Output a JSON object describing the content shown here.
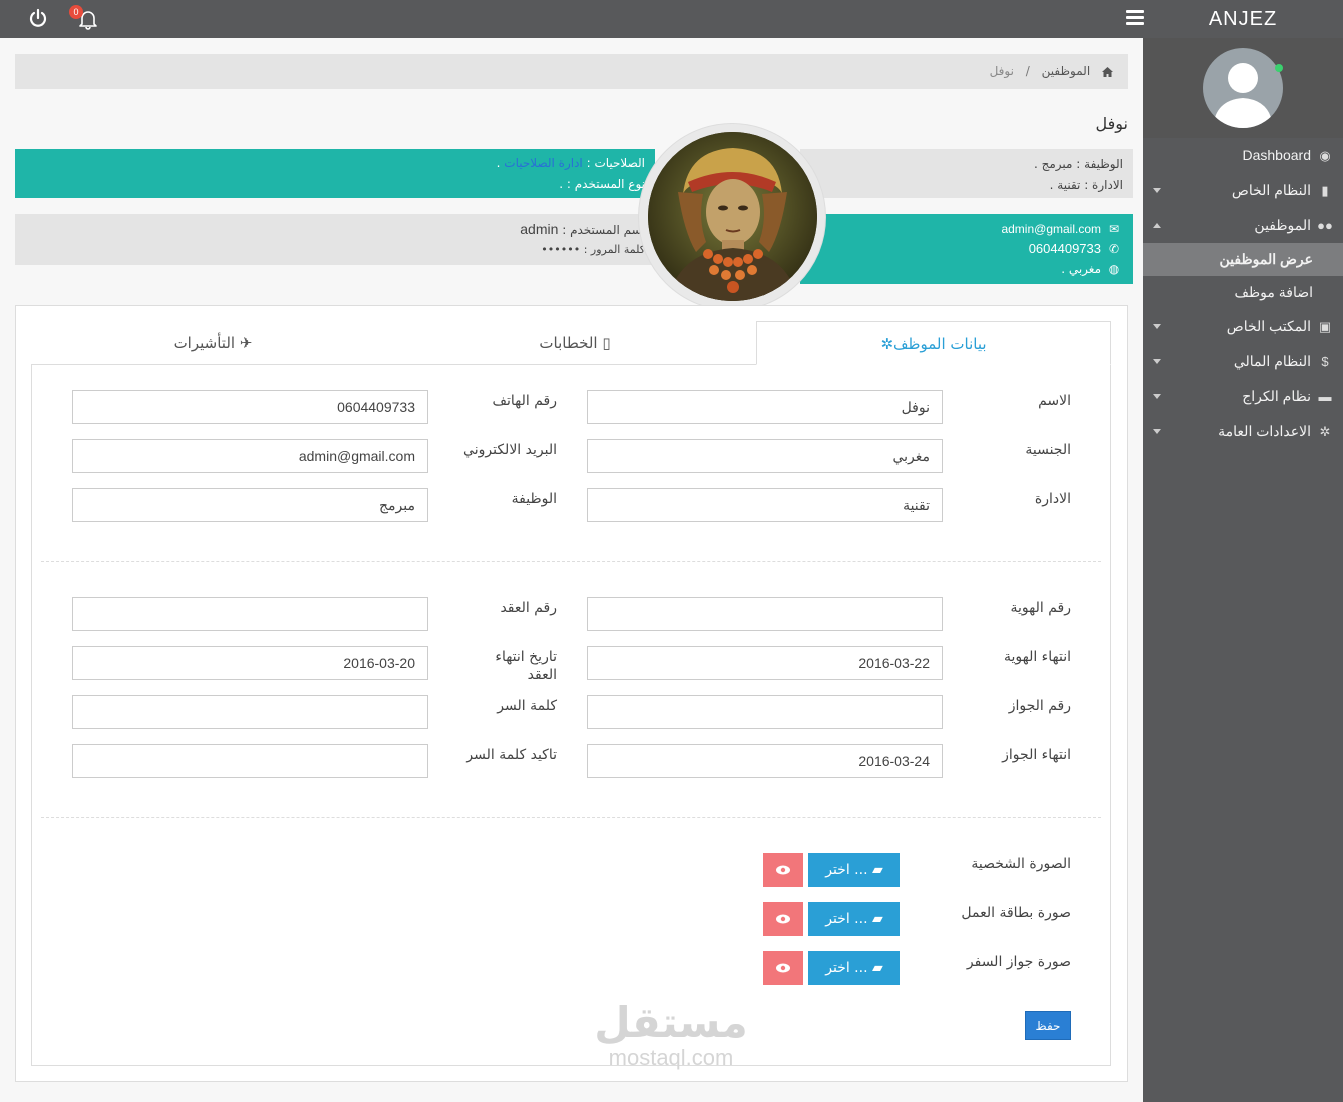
{
  "header": {
    "brand": "ANJEZ",
    "notification_count": "0"
  },
  "sidebar": {
    "items": [
      {
        "label": "Dashboard",
        "icon": "dashboard-icon"
      },
      {
        "label": "النظام الخاص",
        "icon": "bookmark-icon"
      },
      {
        "label": "الموظفين",
        "icon": "users-icon"
      },
      {
        "label": "المكتب الخاص",
        "icon": "office-icon"
      },
      {
        "label": "النظام المالي",
        "icon": "dollar-icon"
      },
      {
        "label": "نظام الكراج",
        "icon": "car-icon"
      },
      {
        "label": "الاعدادات العامة",
        "icon": "cogs-icon"
      }
    ],
    "sub_items": [
      {
        "label": "عرض الموظفين",
        "active": true
      },
      {
        "label": "اضافة موظف",
        "active": false
      }
    ]
  },
  "breadcrumb": {
    "parent": "الموظفين",
    "current": "نوفل",
    "sep": "/"
  },
  "employee": {
    "name": "نوفل",
    "job_line": "الوظيفة : مبرمج .",
    "dept_line": "الادارة : تقنية .",
    "perm_label": "الصلاحيات : ",
    "perm_value": "ادارة الصلاحيات",
    "perm_end": " .",
    "usertype_line": "نوع المستخدم : .",
    "username_label": "اسم المستخدم : ",
    "username": "admin",
    "password_line": "كلمة المرور : ••••••",
    "email": "admin@gmail.com",
    "phone": "0604409733",
    "nationality_line": "مغربي ."
  },
  "tabs": [
    {
      "label": "بيانات الموظف",
      "icon": "cogs-icon",
      "active": true
    },
    {
      "label": "الخطابات",
      "icon": "file-icon",
      "active": false
    },
    {
      "label": "التأشيرات",
      "icon": "plane-icon",
      "active": false
    }
  ],
  "form": {
    "name_label": "الاسم",
    "name_value": "نوفل",
    "phone_label": "رقم الهاتف",
    "phone_value": "0604409733",
    "nationality_label": "الجنسية",
    "nationality_value": "مغربي",
    "email_label": "البريد الالكتروني",
    "email_value": "admin@gmail.com",
    "dept_label": "الادارة",
    "dept_value": "تقنية",
    "job_label": "الوظيفة",
    "job_value": "مبرمج",
    "id_label": "رقم الهوية",
    "id_value": "",
    "contract_label": "رقم العقد",
    "contract_value": "",
    "id_expiry_label": "انتهاء الهوية",
    "id_expiry_value": "2016-03-22",
    "contract_expiry_label_1": "تاريخ انتهاء",
    "contract_expiry_label_2": "العقد",
    "contract_expiry_value": "2016-03-20",
    "passport_label": "رقم الجواز",
    "passport_value": "",
    "password_label": "كلمة السر",
    "password_value": "",
    "passport_expiry_label": "انتهاء الجواز",
    "passport_expiry_value": "2016-03-24",
    "confirm_password_label": "تاكيد كلمة السر",
    "confirm_password_value": "",
    "personal_photo_label": "الصورة الشخصية",
    "work_card_label": "صورة بطاقة العمل",
    "passport_photo_label": "صورة جواز السفر",
    "choose_label": "اختر ...",
    "save_label": "حفظ"
  },
  "watermark": {
    "arabic": "مستقل",
    "latin": "mostaql.com"
  },
  "colors": {
    "teal": "#1fb5a8",
    "topbar": "#58595b",
    "primary": "#2a9fd6",
    "danger": "#f2767a"
  }
}
